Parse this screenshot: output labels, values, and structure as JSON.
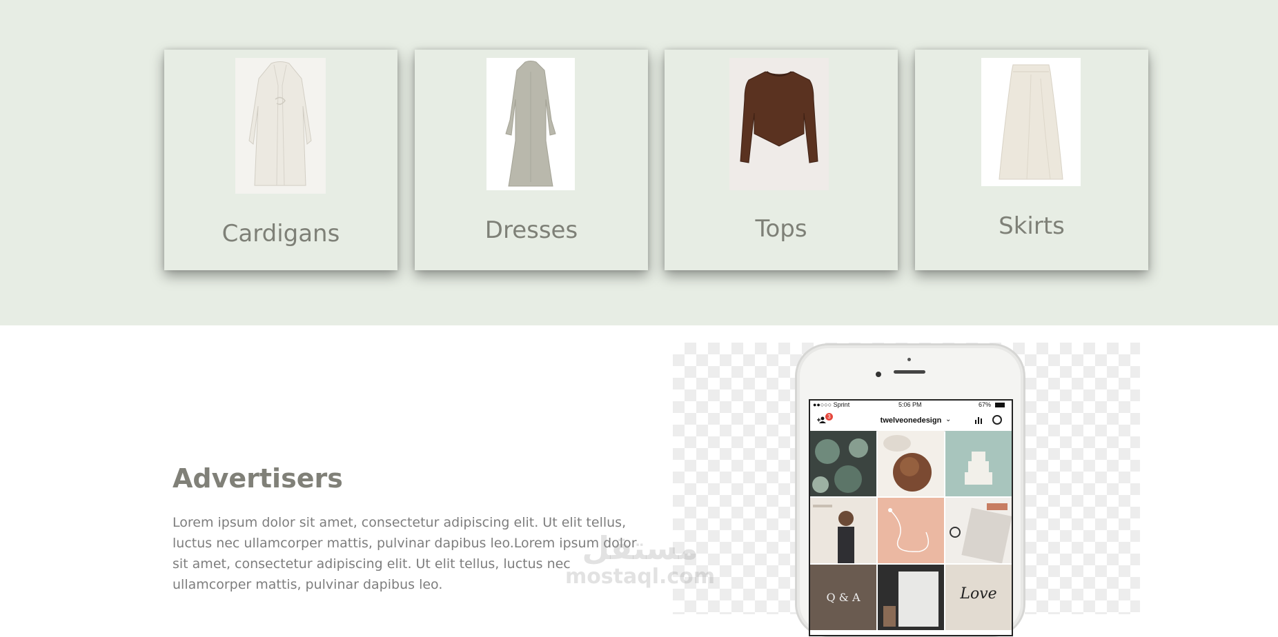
{
  "categories": [
    {
      "label": "Cardigans",
      "icon": "cardigan-image"
    },
    {
      "label": "Dresses",
      "icon": "dress-image"
    },
    {
      "label": "Tops",
      "icon": "top-image"
    },
    {
      "label": "Skirts",
      "icon": "skirt-image"
    }
  ],
  "advertisers": {
    "title": "Advertisers",
    "body": "Lorem ipsum dolor sit amet, consectetur adipiscing elit. Ut elit tellus, luctus nec ullamcorper mattis, pulvinar dapibus leo.Lorem ipsum dolor sit amet, consectetur adipiscing elit. Ut elit tellus, luctus nec ullamcorper mattis, pulvinar dapibus leo."
  },
  "phone": {
    "carrier": "●●○○○ Sprint",
    "time": "5:06 PM",
    "battery": "67%",
    "username": "twelveonedesign",
    "notification_count": "3",
    "grid_text": [
      "Q & A",
      "Love"
    ]
  },
  "watermark": {
    "arabic": "مستقل",
    "latin": "mostaql.com"
  },
  "colors": {
    "band": "#e7ede4",
    "label": "#7e8077",
    "title": "#808078",
    "body": "#7d7d7d",
    "badge": "#e5473c"
  }
}
